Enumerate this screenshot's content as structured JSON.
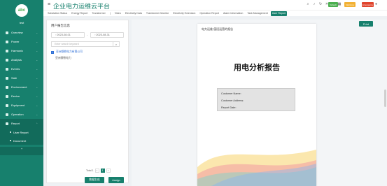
{
  "app": {
    "title": "企业电力运维云平台"
  },
  "sidebar": {
    "logo_text": "abc",
    "user": "test",
    "items": [
      {
        "label": "Overview"
      },
      {
        "label": "Power"
      },
      {
        "label": "Harmonic"
      },
      {
        "label": "Analysis"
      },
      {
        "label": "Events"
      },
      {
        "label": "Safe"
      },
      {
        "label": "Environment"
      },
      {
        "label": "Device"
      },
      {
        "label": "Equipment"
      },
      {
        "label": "Operation"
      },
      {
        "label": "Report"
      }
    ],
    "subitems": [
      {
        "label": "User Report"
      },
      {
        "label": "Document"
      }
    ],
    "collapse": "+"
  },
  "header": {
    "badges": [
      {
        "label": "Default",
        "color": "#4caf50"
      },
      {
        "label": "Warning",
        "color": "#f2b134"
      },
      {
        "label": "Emergency",
        "color": "#e0452e"
      }
    ]
  },
  "tabs": [
    {
      "label": "Substation Status"
    },
    {
      "label": "Energy Report"
    },
    {
      "label": "Transformer"
    },
    {
      "label": "Video"
    },
    {
      "label": "Electricity Data"
    },
    {
      "label": "Transformer Monitor"
    },
    {
      "label": "Electricity Extension"
    },
    {
      "label": "Operation Report"
    },
    {
      "label": "Alarm Information"
    },
    {
      "label": "Task Management"
    },
    {
      "label": "User Report"
    }
  ],
  "left": {
    "title": "用户报告信息",
    "date_start": "2023-08-01",
    "date_sep": "-",
    "date_end": "2023-08-31",
    "search_placeholder": "Enter search keyword",
    "checkbox_label": "亚洲钢铁电力有限公司",
    "row_label": "亚洲钢铁电力",
    "pager": {
      "total": "Total 1",
      "prev": "‹",
      "page": "1",
      "next": "›"
    },
    "btn_generate": "数据生成",
    "btn_assign": "Assign"
  },
  "doc": {
    "print": "Print",
    "header_text": "电力运维 值班运营的报告",
    "title": "用电分析报告",
    "fields": [
      "Customer Name:",
      "Customer Address:",
      "Report Date:"
    ]
  }
}
